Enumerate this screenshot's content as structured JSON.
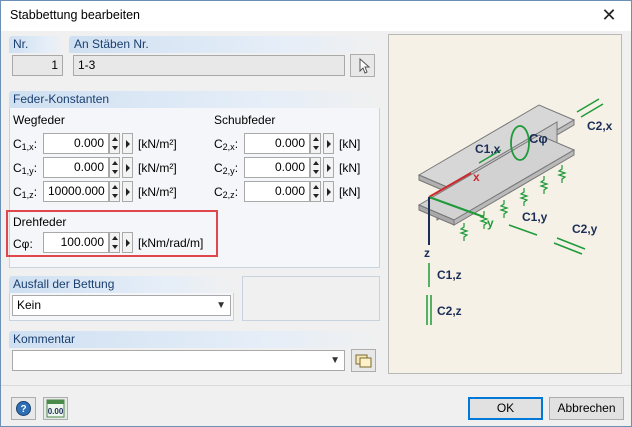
{
  "window": {
    "title": "Stabbettung bearbeiten",
    "close_symbol": "✕"
  },
  "nr": {
    "label": "Nr.",
    "value": "1"
  },
  "members": {
    "label": "An Stäben Nr.",
    "value": "1-3",
    "pick_icon": "cursor-pick-icon"
  },
  "springs": {
    "group_title": "Feder-Konstanten",
    "displacement": {
      "title": "Wegfeder",
      "unit_prefix": "C",
      "rows": [
        {
          "sub": "1,x",
          "value": "0.000",
          "unit": "[kN/m²]"
        },
        {
          "sub": "1,y",
          "value": "0.000",
          "unit": "[kN/m²]"
        },
        {
          "sub": "1,z",
          "value": "10000.000",
          "unit": "[kN/m²]"
        }
      ]
    },
    "shear": {
      "title": "Schubfeder",
      "unit_prefix": "C",
      "rows": [
        {
          "sub": "2,x",
          "value": "0.000",
          "unit": "[kN]"
        },
        {
          "sub": "2,y",
          "value": "0.000",
          "unit": "[kN]"
        },
        {
          "sub": "2,z",
          "value": "0.000",
          "unit": "[kN]"
        }
      ]
    },
    "rotational": {
      "title": "Drehfeder",
      "label": "Cφ:",
      "value": "100.000",
      "unit": "[kNm/rad/m]"
    }
  },
  "failure": {
    "title": "Ausfall der Bettung",
    "selected": "Kein"
  },
  "comment": {
    "title": "Kommentar",
    "value": ""
  },
  "buttons": {
    "ok": "OK",
    "cancel": "Abbrechen",
    "help_icon": "help-icon",
    "units_icon": "units-icon",
    "units_text": "0.00"
  },
  "figure": {
    "labels": {
      "c1x": "C1,x",
      "cphi": "Cφ",
      "c2x": "C2,x",
      "x": "x",
      "y": "y",
      "z": "z",
      "c1y": "C1,y",
      "c2y": "C2,y",
      "c1z": "C1,z",
      "c2z": "C2,z"
    },
    "colors": {
      "beam": "#c9c9c9",
      "green": "#1f9a3a",
      "red": "#d0282c",
      "label": "#1c2e57"
    }
  },
  "colors": {
    "highlight": "#e0474c",
    "group_head": "#cfe0f2",
    "title_text": "#1a3f6e"
  }
}
